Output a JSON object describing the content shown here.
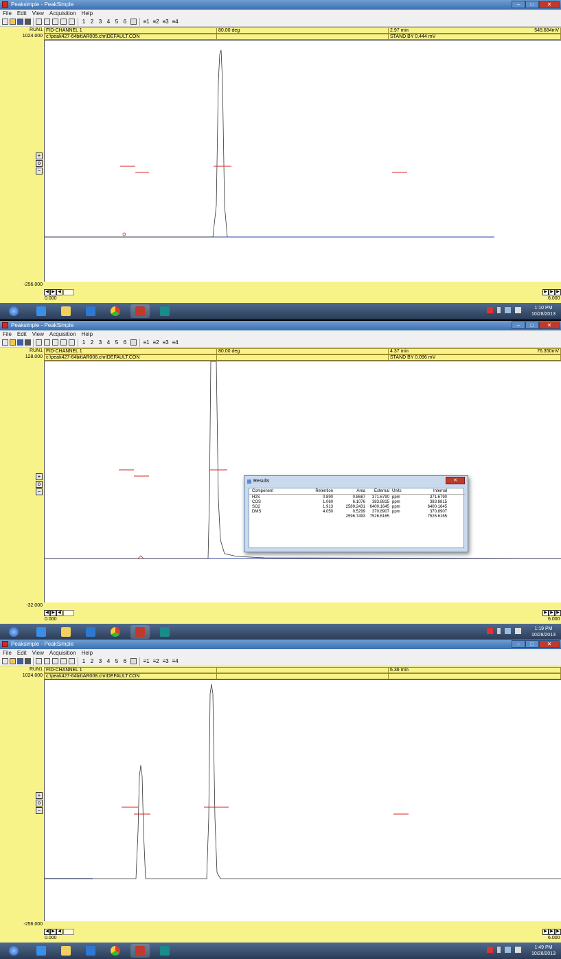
{
  "app": {
    "title": "Peaksimple - PeakSimple",
    "menu": [
      "File",
      "Edit",
      "View",
      "Acquisition",
      "Help"
    ],
    "toolbar_numbers": [
      "1",
      "2",
      "3",
      "4",
      "5",
      "6"
    ],
    "toolbar_channels": [
      "1",
      "2",
      "3",
      "4"
    ]
  },
  "panels": [
    {
      "run": "RUN1",
      "channel": "FID-CHANNEL 1",
      "temp": "80.00 deg",
      "time": "2.97 min",
      "signal": "545.684mV",
      "y_top": "1024.000",
      "file": "c:\\peak427-64bit\\AR005.chr\\DEFAULT.CON",
      "standby": "STAND BY 0.444 mV",
      "y_bottom": "-256.000",
      "x_start": "0.000",
      "x_end": "6.000",
      "clock_time": "1:10 PM",
      "clock_date": "10/28/2013"
    },
    {
      "run": "RUN1",
      "channel": "FID-CHANNEL 1",
      "temp": "80.00 deg",
      "time": "4.37 min",
      "signal": "76.350mV",
      "y_top": "128.000",
      "file": "c:\\peak427-64bit\\AR006.chr\\DEFAULT.CON",
      "standby": "STAND BY 0.096 mV",
      "y_bottom": "-32.000",
      "x_start": "0.000",
      "x_end": "6.000",
      "clock_time": "1:19 PM",
      "clock_date": "10/28/2013"
    },
    {
      "run": "RUN1",
      "channel": "FID-CHANNEL 1",
      "temp": "",
      "time": "6.36 min",
      "signal": "",
      "y_top": "1024.000",
      "file": "c:\\peak427-64bit\\AR008.chr\\DEFAULT.CON",
      "standby": "",
      "y_bottom": "-256.000",
      "x_start": "0.000",
      "x_end": "6.000",
      "clock_time": "1:49 PM",
      "clock_date": "10/28/2013"
    }
  ],
  "results": {
    "title": "Results",
    "columns": [
      "Component",
      "Retention",
      "Area",
      "External",
      "Units",
      "Internal"
    ],
    "rows": [
      [
        "H2S",
        "0.890",
        "0.8687",
        "371.6790",
        "ppm",
        "371.6790"
      ],
      [
        "COS",
        "1.060",
        "6.1076",
        "383.8815",
        "ppm",
        "383.8815"
      ],
      [
        "SO2",
        "1.913",
        "2589.2431",
        "6400.1645",
        "ppm",
        "6400.1645"
      ],
      [
        "DMS",
        "4.050",
        "0.5299",
        "370.8907",
        "ppm",
        "370.8907"
      ]
    ],
    "totals": [
      "",
      "",
      "2596.7493",
      "7526.6165",
      "",
      "7526.6165"
    ]
  },
  "colors": {
    "title_bar": "#3b6fb0",
    "chart_background": "#f7f389",
    "plot_area": "#ffffff",
    "baseline": "#2b3f9e",
    "trace": "#333333",
    "markers": "#d42020",
    "taskbar": "#2a3b57"
  },
  "icons": {
    "taskbar": [
      "start-orb-icon",
      "ie-icon",
      "explorer-icon",
      "media-player-icon",
      "chrome-icon",
      "peaksimple-icon",
      "publisher-icon"
    ],
    "tray": [
      "action-center-flag-icon",
      "show-hidden-icon",
      "network-icon",
      "volume-icon"
    ]
  }
}
